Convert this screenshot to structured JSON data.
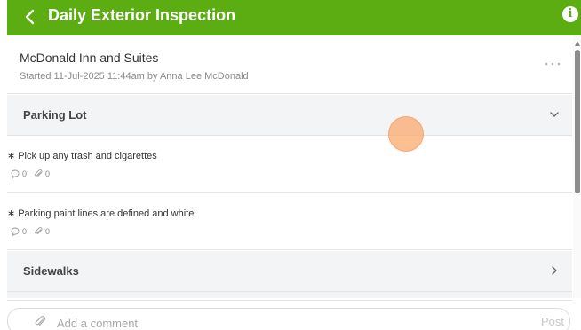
{
  "header": {
    "title": "Daily Exterior Inspection",
    "back_icon": "chevron-left-icon",
    "info_icon": "info-icon",
    "info_glyph": "i",
    "color": "#5cad12"
  },
  "site": {
    "name": "McDonald Inn and Suites",
    "meta": "Started 11-Jul-2025 11:44am by Anna Lee McDonald",
    "more_icon": "more-horizontal-icon"
  },
  "sections": [
    {
      "title": "Parking Lot",
      "state": "expanded",
      "items": [
        {
          "label": "Pick up any trash and cigarettes",
          "required_mark": "∗",
          "comments": "0",
          "attachments": "0"
        },
        {
          "label": "Parking paint lines are defined and white",
          "required_mark": "∗",
          "comments": "0",
          "attachments": "0"
        }
      ]
    },
    {
      "title": "Sidewalks",
      "state": "collapsed"
    }
  ],
  "comment_bar": {
    "placeholder": "Add a comment",
    "post_label": "Post",
    "attach_icon": "paperclip-icon"
  }
}
